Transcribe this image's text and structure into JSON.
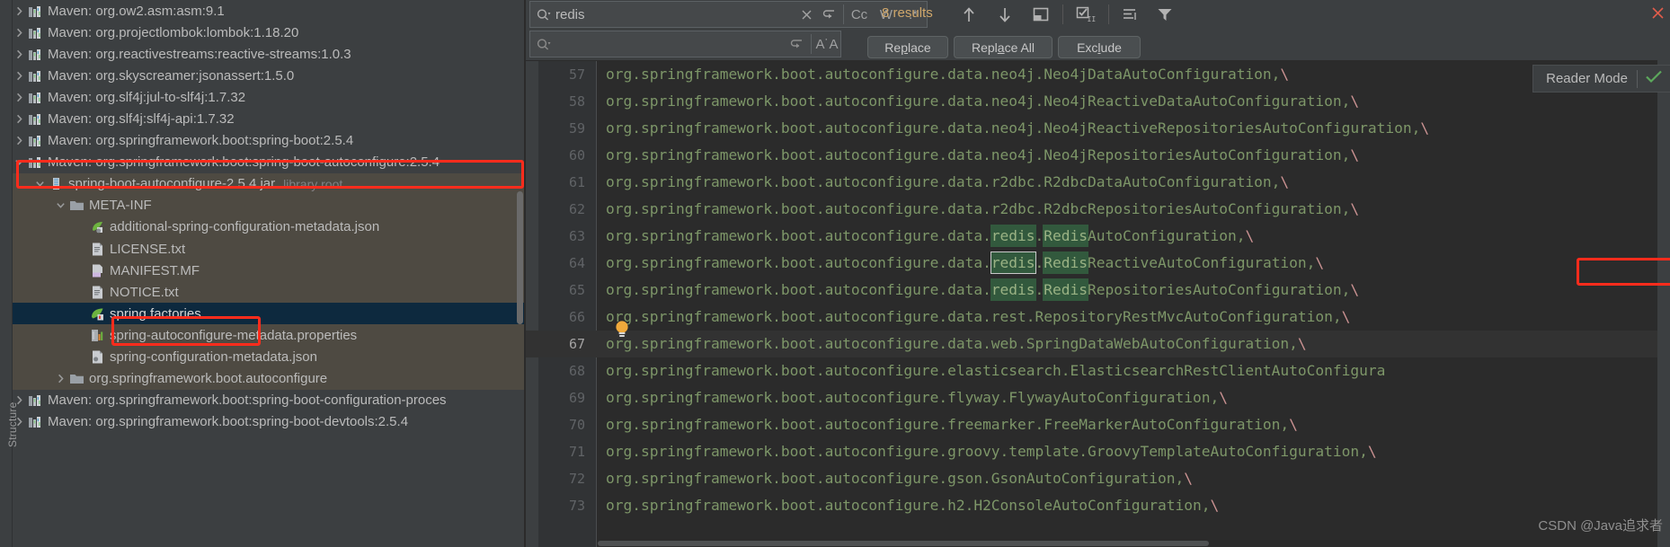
{
  "tree": {
    "structure_label": "Structure",
    "rows": [
      {
        "indent": 0,
        "arrow": "right",
        "icon": "maven-library-icon",
        "label": "Maven: org.ow2.asm:asm:9.1",
        "style": "normal"
      },
      {
        "indent": 0,
        "arrow": "right",
        "icon": "maven-library-icon",
        "label": "Maven: org.projectlombok:lombok:1.18.20",
        "style": "normal"
      },
      {
        "indent": 0,
        "arrow": "right",
        "icon": "maven-library-icon",
        "label": "Maven: org.reactivestreams:reactive-streams:1.0.3",
        "style": "normal"
      },
      {
        "indent": 0,
        "arrow": "right",
        "icon": "maven-library-icon",
        "label": "Maven: org.skyscreamer:jsonassert:1.5.0",
        "style": "normal"
      },
      {
        "indent": 0,
        "arrow": "right",
        "icon": "maven-library-icon",
        "label": "Maven: org.slf4j:jul-to-slf4j:1.7.32",
        "style": "normal"
      },
      {
        "indent": 0,
        "arrow": "right",
        "icon": "maven-library-icon",
        "label": "Maven: org.slf4j:slf4j-api:1.7.32",
        "style": "normal"
      },
      {
        "indent": 0,
        "arrow": "right",
        "icon": "maven-library-icon",
        "label": "Maven: org.springframework.boot:spring-boot:2.5.4",
        "style": "normal"
      },
      {
        "indent": 0,
        "arrow": "down",
        "icon": "maven-library-icon",
        "label": "Maven: org.springframework.boot:spring-boot-autoconfigure:2.5.4",
        "style": "highlighted"
      },
      {
        "indent": 1,
        "arrow": "down",
        "icon": "jar-icon",
        "label": "spring-boot-autoconfigure-2.5.4.jar",
        "suffix": "library root",
        "style": "lib"
      },
      {
        "indent": 2,
        "arrow": "down",
        "icon": "folder-icon",
        "label": "META-INF",
        "style": "lib"
      },
      {
        "indent": 3,
        "arrow": "none",
        "icon": "spring-json-icon",
        "label": "additional-spring-configuration-metadata.json",
        "style": "lib"
      },
      {
        "indent": 3,
        "arrow": "none",
        "icon": "text-file-icon",
        "label": "LICENSE.txt",
        "style": "lib"
      },
      {
        "indent": 3,
        "arrow": "none",
        "icon": "manifest-file-icon",
        "label": "MANIFEST.MF",
        "style": "lib"
      },
      {
        "indent": 3,
        "arrow": "none",
        "icon": "text-file-icon",
        "label": "NOTICE.txt",
        "style": "lib"
      },
      {
        "indent": 3,
        "arrow": "none",
        "icon": "spring-factories-icon",
        "label": "spring.factories",
        "style": "selected"
      },
      {
        "indent": 3,
        "arrow": "none",
        "icon": "properties-file-icon",
        "label": "spring-autoconfigure-metadata.properties",
        "style": "lib"
      },
      {
        "indent": 3,
        "arrow": "none",
        "icon": "json-file-icon",
        "label": "spring-configuration-metadata.json",
        "style": "lib"
      },
      {
        "indent": 2,
        "arrow": "right",
        "icon": "folder-icon",
        "label": "org.springframework.boot.autoconfigure",
        "style": "lib"
      },
      {
        "indent": 0,
        "arrow": "right",
        "icon": "maven-library-icon",
        "label": "Maven: org.springframework.boot:spring-boot-configuration-proces",
        "style": "normal"
      },
      {
        "indent": 0,
        "arrow": "right",
        "icon": "maven-library-icon",
        "label": "Maven: org.springframework.boot:spring-boot-devtools:2.5.4",
        "style": "normal"
      }
    ]
  },
  "find": {
    "search_value": "redis",
    "search_placeholder": "",
    "replace_value": "",
    "replace_placeholder": "",
    "clear_icon": "close-icon",
    "history_icon": "search-history-icon",
    "magnifier_icon": "search-icon",
    "options": [
      {
        "name": "match-case-toggle",
        "label": "Cc"
      },
      {
        "name": "words-toggle",
        "label": "W"
      },
      {
        "name": "regex-toggle",
        "label": ".*"
      }
    ],
    "replace_preserve_case_label": "A˙A",
    "results_count": "8 results",
    "toolbar_icons": [
      {
        "name": "previous-occurrence-icon"
      },
      {
        "name": "next-occurrence-icon"
      },
      {
        "name": "open-in-find-window-icon"
      },
      {
        "name": "select-all-occurrences-icon"
      },
      {
        "name": "toggle-multiline-icon"
      },
      {
        "name": "filter-icon"
      }
    ],
    "buttons": [
      {
        "name": "replace-button",
        "pre": "Re",
        "mnemonic": "p",
        "post": "lace"
      },
      {
        "name": "replace-all-button",
        "pre": "Repl",
        "mnemonic": "a",
        "post": "ce All"
      },
      {
        "name": "exclude-button",
        "pre": "Exc",
        "mnemonic": "l",
        "post": "ude"
      }
    ]
  },
  "reader_mode": {
    "label": "Reader Mode",
    "check_icon": "check-icon",
    "check_color": "#5ca85c"
  },
  "close_icon": "close-icon",
  "watermark": "CSDN @Java追求者",
  "code": {
    "lines": [
      {
        "num": "57",
        "prefix": "org.springframework.boot.autoconfigure.data.neo4j.Neo4jDataAutoConfiguration,",
        "suffix": "\\"
      },
      {
        "num": "58",
        "prefix": "org.springframework.boot.autoconfigure.data.neo4j.Neo4jReactiveDataAutoConfiguration,",
        "suffix": "\\"
      },
      {
        "num": "59",
        "prefix": "org.springframework.boot.autoconfigure.data.neo4j.Neo4jReactiveRepositoriesAutoConfiguration,",
        "suffix": "\\"
      },
      {
        "num": "60",
        "prefix": "org.springframework.boot.autoconfigure.data.neo4j.Neo4jRepositoriesAutoConfiguration,",
        "suffix": "\\"
      },
      {
        "num": "61",
        "prefix": "org.springframework.boot.autoconfigure.data.r2dbc.R2dbcDataAutoConfiguration,",
        "suffix": "\\"
      },
      {
        "num": "62",
        "prefix": "org.springframework.boot.autoconfigure.data.r2dbc.R2dbcRepositoriesAutoConfiguration,",
        "suffix": "\\"
      },
      {
        "num": "63",
        "prefix": "org.springframework.boot.autoconfigure.data.",
        "m1": "redis",
        "mid": ".",
        "m2": "Redis",
        "rest": "AutoConfiguration,",
        "suffix": "\\",
        "boxed": true
      },
      {
        "num": "64",
        "prefix": "org.springframework.boot.autoconfigure.data.",
        "m1": "redis",
        "mid": ".",
        "m2": "Redis",
        "rest": "ReactiveAutoConfiguration,",
        "suffix": "\\",
        "current_match": true
      },
      {
        "num": "65",
        "prefix": "org.springframework.boot.autoconfigure.data.",
        "m1": "redis",
        "mid": ".",
        "m2": "Redis",
        "rest": "RepositoriesAutoConfiguration,",
        "suffix": "\\"
      },
      {
        "num": "66",
        "prefix": "org.springframework.boot.autoconfigure.data.rest.RepositoryRestMvcAutoConfiguration,",
        "suffix": "\\",
        "bulb": true
      },
      {
        "num": "67",
        "prefix": "org.springframework.boot.autoconfigure.data.web.SpringDataWebAutoConfiguration,",
        "suffix": "\\",
        "current": true
      },
      {
        "num": "68",
        "prefix": "org.springframework.boot.autoconfigure.elasticsearch.ElasticsearchRestClientAutoConfigura",
        "suffix": ""
      },
      {
        "num": "69",
        "prefix": "org.springframework.boot.autoconfigure.flyway.FlywayAutoConfiguration,",
        "suffix": "\\"
      },
      {
        "num": "70",
        "prefix": "org.springframework.boot.autoconfigure.freemarker.FreeMarkerAutoConfiguration,",
        "suffix": "\\"
      },
      {
        "num": "71",
        "prefix": "org.springframework.boot.autoconfigure.groovy.template.GroovyTemplateAutoConfiguration,",
        "suffix": "\\"
      },
      {
        "num": "72",
        "prefix": "org.springframework.boot.autoconfigure.gson.GsonAutoConfiguration,",
        "suffix": "\\"
      },
      {
        "num": "73",
        "prefix": "org.springframework.boot.autoconfigure.h2.H2ConsoleAutoConfiguration,",
        "suffix": "\\"
      }
    ]
  },
  "colors": {
    "tree_bg": "#3c3f41",
    "library_row_bg": "#4e4a42",
    "selection_bg": "#0d293e",
    "editor_bg": "#2b2b2b",
    "code_green": "#7d9668",
    "match_green": "#32593d",
    "annotation_red": "#fe2c1c",
    "results_amber": "#cfa76b"
  }
}
